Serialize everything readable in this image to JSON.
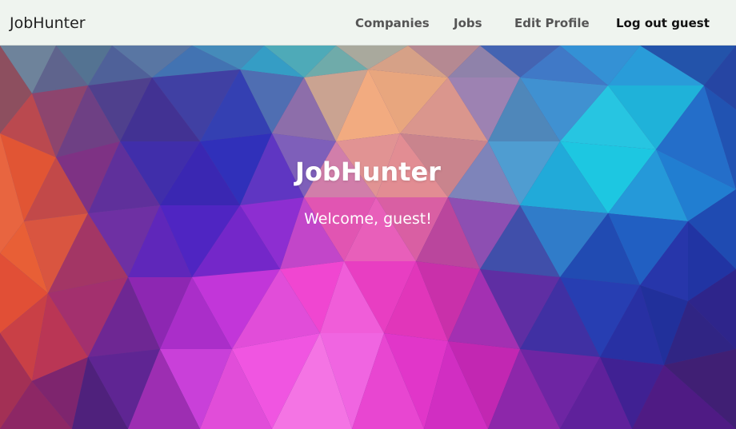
{
  "navbar": {
    "brand": "JobHunter",
    "links": {
      "companies": "Companies",
      "jobs": "Jobs",
      "edit_profile": "Edit Profile",
      "logout": "Log out guest"
    }
  },
  "hero": {
    "title": "JobHunter",
    "subtitle": "Welcome, guest!"
  },
  "colors": {
    "navbar_bg": "#eff4ef",
    "text_dark": "#222222",
    "nav_link": "#555555",
    "hero_text": "#ffffff"
  }
}
